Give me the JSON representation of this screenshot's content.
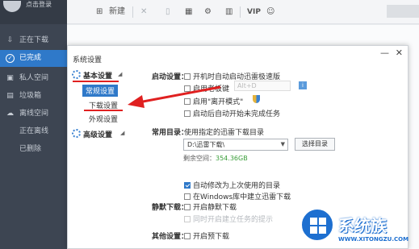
{
  "app": {
    "login_text": "点击登录",
    "nav": [
      {
        "icon": "download-icon",
        "glyph": "⇩",
        "label": "正在下载"
      },
      {
        "icon": "check-circle-icon",
        "glyph": "✓",
        "label": "已完成"
      },
      {
        "icon": "private-space-icon",
        "glyph": "▣",
        "label": "私人空间"
      },
      {
        "icon": "trash-icon",
        "glyph": "▤",
        "label": "垃圾箱"
      },
      {
        "icon": "offline-icon",
        "glyph": "☁",
        "label": "离线空间"
      },
      {
        "icon": "",
        "glyph": "",
        "label": "正在离线"
      },
      {
        "icon": "",
        "glyph": "",
        "label": "已删除"
      }
    ],
    "toolbar": {
      "new_label": "新建",
      "vip_label": "VIP"
    }
  },
  "dialog": {
    "title": "系统设置",
    "sidebar": {
      "basic_label": "基本设置",
      "basic_items": [
        "常规设置",
        "下载设置",
        "外观设置"
      ],
      "advanced_label": "高级设置"
    },
    "startup": {
      "label": "启动设置：",
      "opt_autostart": "开机时自动启动迅雷极速版",
      "opt_bosskey": "启用老板键",
      "hotkey": "Alt+D",
      "opt_mode": "启用\"离开模式\"",
      "opt_resume": "启动后自动开始未完成任务"
    },
    "common_dir": {
      "label": "常用目录：",
      "desc": "使用指定的迅雷下载目录",
      "path": "D:\\迅雷下载\\",
      "browse_button": "选择目录",
      "free_label": "剩余空间：",
      "free_value": "354.36GB",
      "opt_last_dir": "自动修改为上次使用的目录",
      "opt_windows_lib": "在Windows库中建立迅雷下载"
    },
    "silent": {
      "label": "静默下载：",
      "opt_silent": "开启静默下载",
      "opt_disabled": "同时开启建立任务的提示"
    },
    "other": {
      "label": "其他设置：",
      "opt_preload": "开启预下载"
    }
  },
  "watermark": {
    "text": "系统族",
    "url": "WWW.XITONGZU.COM"
  },
  "colors": {
    "accent": "#2f79c9",
    "annotation": "#e02020",
    "sidebar_bg": "#3d4552",
    "free_space": "#3a9e3a"
  }
}
